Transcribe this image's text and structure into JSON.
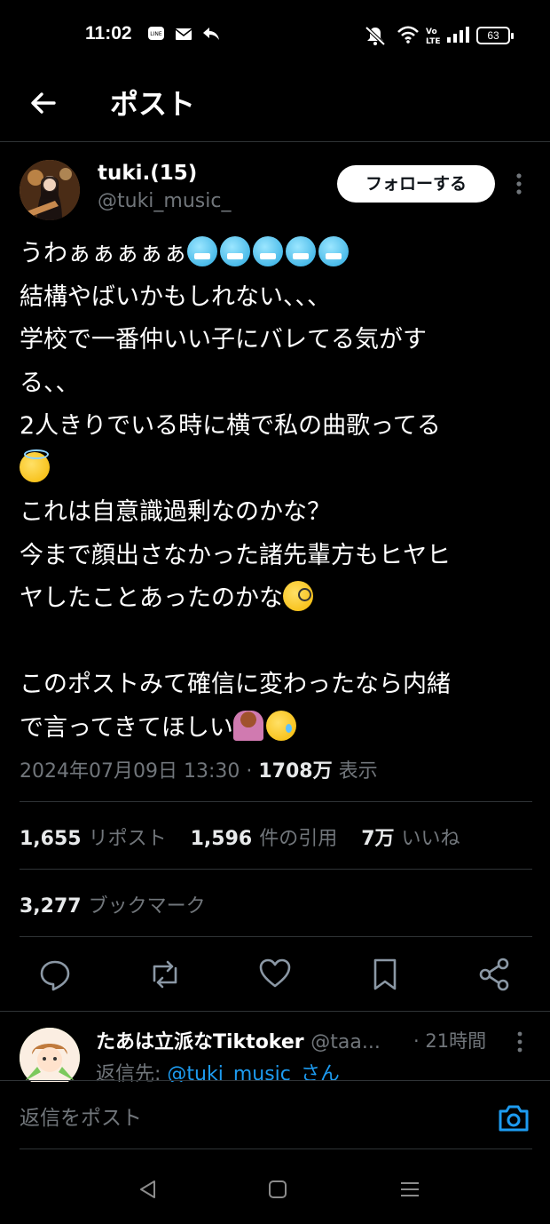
{
  "status_bar": {
    "time": "11:02",
    "notification_icons": [
      "line-app-icon",
      "mail-icon",
      "reply-arrow-icon"
    ],
    "system_icons": [
      "mute-bell-icon",
      "wifi-icon",
      "volte-icon",
      "signal-icon"
    ],
    "battery": "63"
  },
  "header": {
    "back_icon": "arrow-left-icon",
    "title": "ポスト"
  },
  "author": {
    "name": "tuki.(15)",
    "handle": "@tuki_music_",
    "follow_label": "フォローする"
  },
  "tweet": {
    "lines": [
      "うわぁぁぁぁぁ",
      "結構やばいかもしれない、、、",
      "学校で一番仲いい子にバレてる気がす",
      "る、、",
      "2人きりでいる時に横で私の曲歌ってる",
      "",
      "これは自意識過剰なのかな？",
      "今まで顔出さなかった諸先輩方もヒヤヒ",
      "ヤしたことあったのかな",
      "",
      "このポストみて確信に変わったなら内緒",
      "で言ってきてほしい"
    ],
    "emojis": {
      "line1": "cold-face-emoji x5",
      "line6": "smiling-face-with-halo-emoji",
      "line9": "face-with-monocle-emoji",
      "line12": [
        "person-bowing-emoji",
        "smiling-face-with-tear-emoji"
      ]
    },
    "timestamp": "2024年07月09日 13:30",
    "separator": "·",
    "views_count": "1708万",
    "views_label": "表示"
  },
  "stats": {
    "reposts_count": "1,655",
    "reposts_label": "リポスト",
    "quotes_count": "1,596",
    "quotes_label": "件の引用",
    "likes_count": "7万",
    "likes_label": "いいね",
    "bookmarks_count": "3,277",
    "bookmarks_label": "ブックマーク"
  },
  "actions": [
    "reply-icon",
    "repost-icon",
    "like-icon",
    "bookmark-icon",
    "share-icon"
  ],
  "reply": {
    "name": "たあは立派なTiktoker",
    "handle": "@taa...",
    "time": "· 21時間",
    "reply_to_label": "返信先:",
    "reply_to_mention": "@tuki_music_さん"
  },
  "compose": {
    "placeholder": "返信をポスト"
  },
  "colors": {
    "background": "#000000",
    "text": "#e7e9ea",
    "muted": "#71767b",
    "accent": "#1d9bf0",
    "divider": "#2f3336"
  }
}
